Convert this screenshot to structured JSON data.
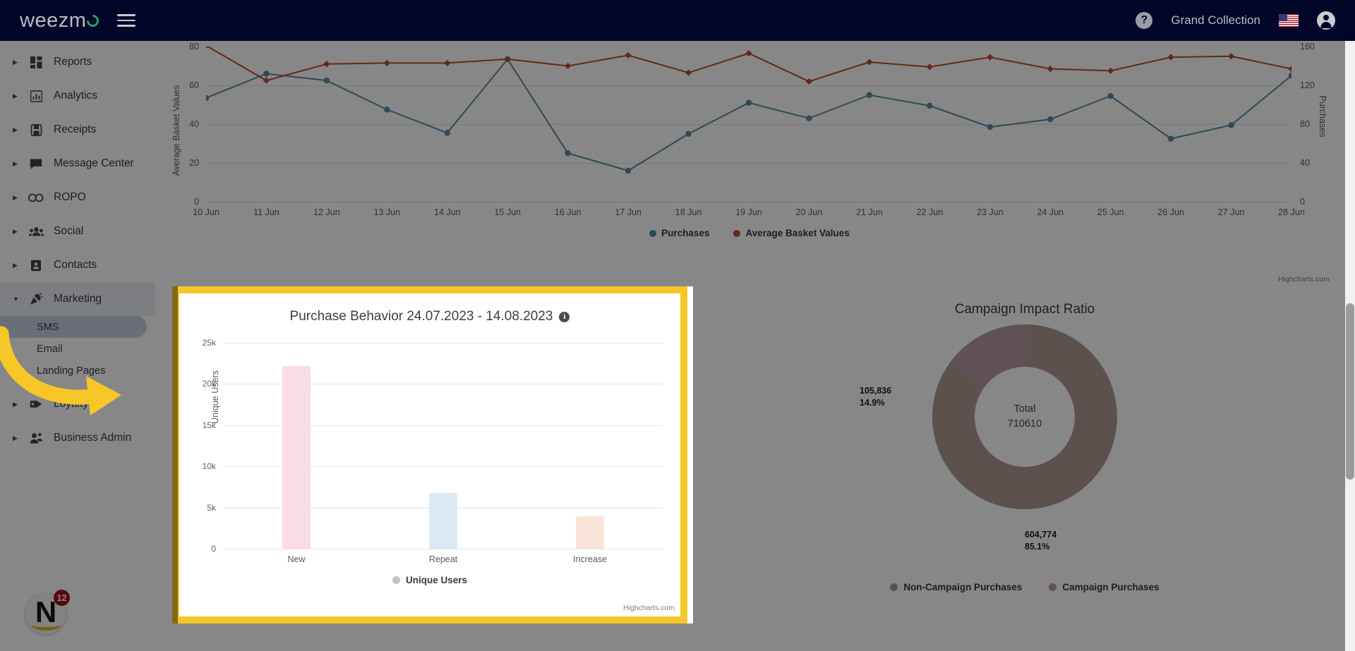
{
  "topbar": {
    "brand": "weezm",
    "menu_icon": "hamburger-icon",
    "help_icon": "?",
    "account_name": "Grand Collection",
    "language_flag": "us-flag",
    "avatar": "user-avatar"
  },
  "sidebar": {
    "items": [
      {
        "label": "Reports",
        "icon": "dashboard-icon",
        "expanded": false
      },
      {
        "label": "Analytics",
        "icon": "bar-chart-icon",
        "expanded": false
      },
      {
        "label": "Receipts",
        "icon": "receipt-icon",
        "expanded": false
      },
      {
        "label": "Message Center",
        "icon": "message-icon",
        "expanded": false
      },
      {
        "label": "ROPO",
        "icon": "infinity-icon",
        "expanded": false
      },
      {
        "label": "Social",
        "icon": "people-icon",
        "expanded": false
      },
      {
        "label": "Contacts",
        "icon": "contact-card-icon",
        "expanded": false
      },
      {
        "label": "Marketing",
        "icon": "megaphone-icon",
        "expanded": true
      },
      {
        "label": "Loyalty",
        "icon": "tag-icon",
        "expanded": false
      },
      {
        "label": "Business Admin",
        "icon": "admin-icon",
        "expanded": false
      }
    ],
    "marketing_children": [
      {
        "label": "SMS",
        "selected": true
      },
      {
        "label": "Email",
        "selected": false
      },
      {
        "label": "Landing Pages",
        "selected": false
      }
    ],
    "widget": {
      "logo_letter": "N",
      "badge_count": "12"
    }
  },
  "chart_data": [
    {
      "type": "line",
      "title": "",
      "xlabel": "",
      "ylabel": "Average Basket Values",
      "y2label": "Purchases",
      "ylim": [
        0,
        80
      ],
      "y2lim": [
        0,
        160
      ],
      "yticks": [
        "0",
        "20",
        "40",
        "60",
        "80"
      ],
      "y2ticks": [
        "0",
        "40",
        "80",
        "120",
        "160"
      ],
      "grid": true,
      "legend_position": "bottom",
      "categories": [
        "10 Jun",
        "11 Jun",
        "12 Jun",
        "13 Jun",
        "14 Jun",
        "15 Jun",
        "16 Jun",
        "17 Jun",
        "18 Jun",
        "19 Jun",
        "20 Jun",
        "21 Jun",
        "22 Jun",
        "23 Jun",
        "24 Jun",
        "25 Jun",
        "26 Jun",
        "27 Jun",
        "28 Jun"
      ],
      "series": [
        {
          "name": "Purchases",
          "color": "#5c8ca3",
          "axis": "right",
          "values": [
            107,
            132,
            125,
            95,
            71,
            147,
            50,
            32,
            70,
            102,
            86,
            110,
            99,
            77,
            85,
            109,
            65,
            79,
            130
          ]
        },
        {
          "name": "Average Basket Values",
          "color": "#b8502e",
          "axis": "left",
          "values": [
            80.5,
            62.5,
            71,
            71.5,
            71.5,
            73.5,
            70,
            75.5,
            66.5,
            76.5,
            62,
            72,
            69.5,
            74.5,
            68.5,
            67.5,
            74.5,
            75,
            68.5
          ]
        }
      ],
      "credit": "Highcharts.com"
    },
    {
      "type": "bar",
      "title": "Purchase Behavior 24.07.2023 - 14.08.2023",
      "info_tooltip": "i",
      "xlabel": "",
      "ylabel": "Unique Users",
      "ylim": [
        0,
        25000
      ],
      "yticks": [
        "0",
        "5k",
        "10k",
        "15k",
        "20k",
        "25k"
      ],
      "grid": true,
      "legend_position": "bottom",
      "legend_label": "Unique Users",
      "legend_color": "#c2c2c2",
      "categories": [
        "New",
        "Repeat",
        "Increase"
      ],
      "values": [
        22200,
        6800,
        3900
      ],
      "colors": [
        "#fadbe8",
        "#d9eaf4",
        "#fae3d8"
      ],
      "credit": "Highcharts.com"
    },
    {
      "type": "pie",
      "subtype": "donut",
      "title": "Campaign Impact Ratio",
      "center_caption": "Total",
      "center_value": "710610",
      "labels": [
        "Non-Campaign Purchases",
        "Campaign Purchases"
      ],
      "values": [
        604774,
        105836
      ],
      "percents": [
        "85.1%",
        "14.9%"
      ],
      "value_labels": [
        "604,774",
        "105,836"
      ],
      "colors": [
        "#b09a93",
        "#b49aa5"
      ],
      "legend_position": "bottom"
    }
  ],
  "overlay": {
    "highlight_color": "#f7c728",
    "arrow": "yellow-arrow-pointing-right",
    "dim": true
  }
}
